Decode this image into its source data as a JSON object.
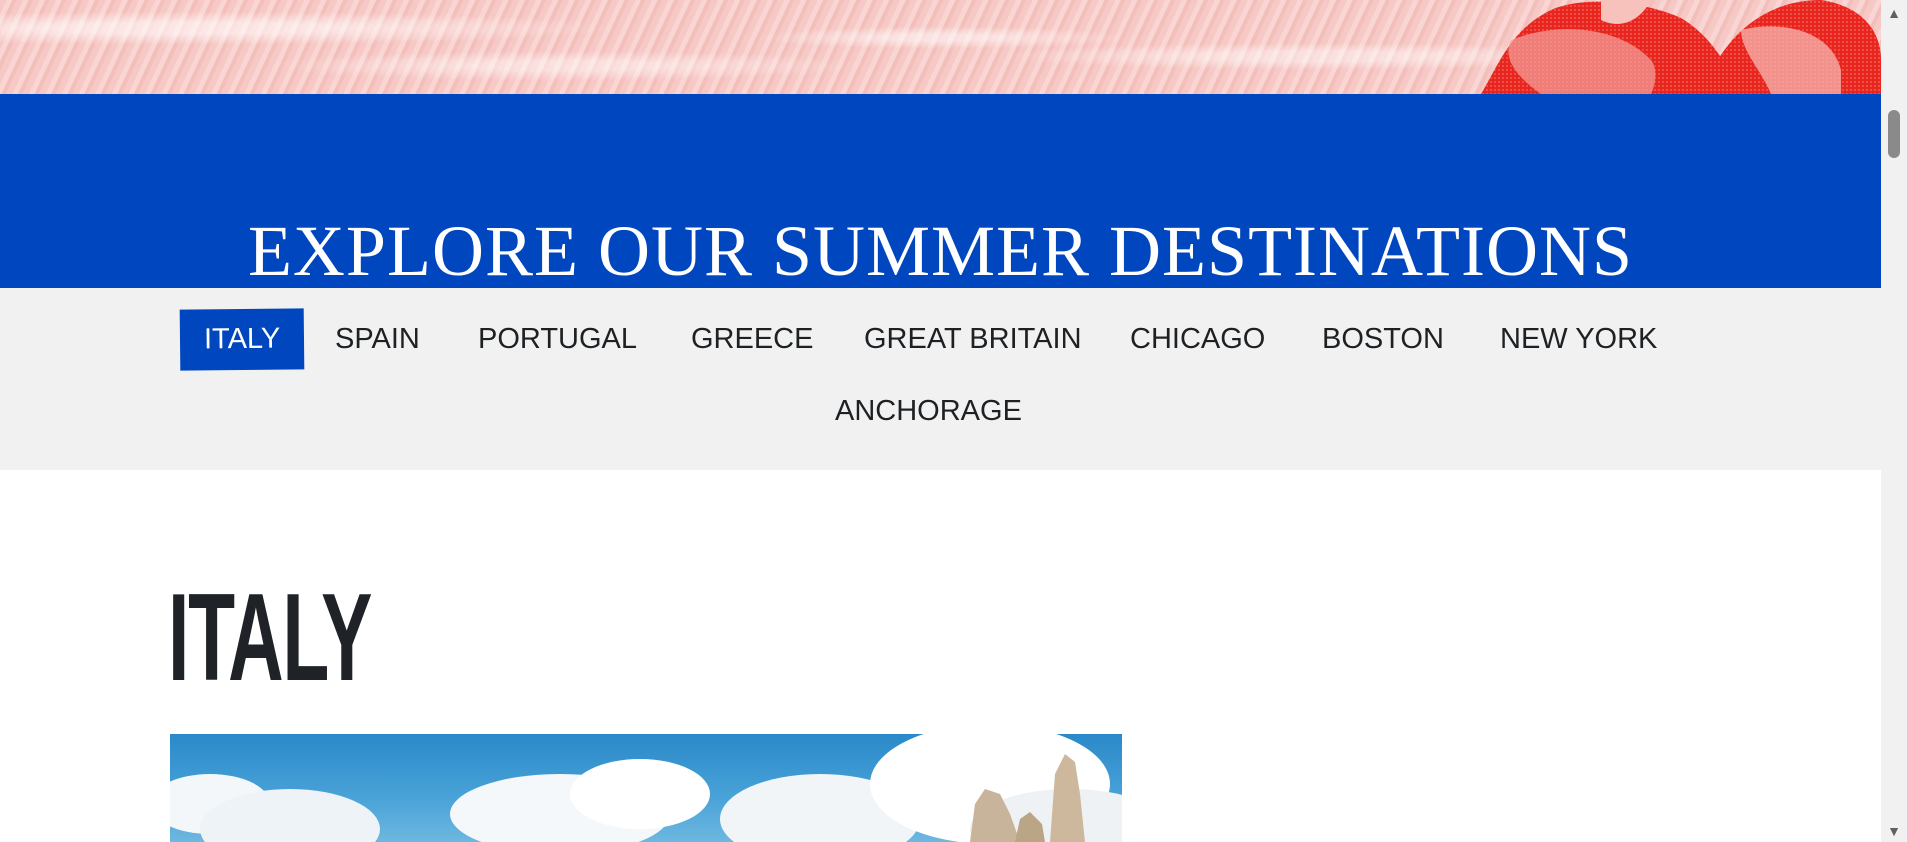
{
  "banner": {
    "title": "EXPLORE OUR SUMMER DESTINATIONS"
  },
  "tabs": [
    {
      "label": "ITALY",
      "active": true
    },
    {
      "label": "SPAIN"
    },
    {
      "label": "PORTUGAL"
    },
    {
      "label": "GREECE"
    },
    {
      "label": "GREAT BRITAIN"
    },
    {
      "label": "CHICAGO"
    },
    {
      "label": "BOSTON"
    },
    {
      "label": "NEW YORK"
    },
    {
      "label": "ANCHORAGE"
    }
  ],
  "section": {
    "title": "ITALY"
  },
  "colors": {
    "brand_blue": "#0047bf",
    "tabs_bg": "#f1f1f1",
    "hero_red": "#e8261f"
  },
  "scrollbar": {
    "up_icon": "chevron-up-icon",
    "down_icon": "chevron-down-icon"
  }
}
